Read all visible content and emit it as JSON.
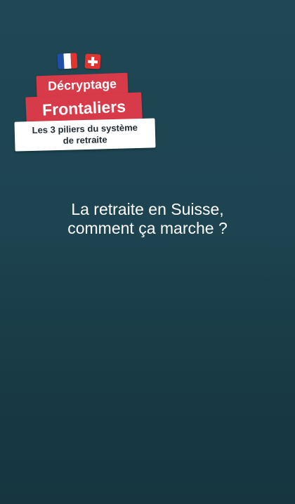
{
  "overlay": {
    "flags": [
      "france-flag-icon",
      "switzerland-flag-icon"
    ],
    "sticker_primary": "Décryptage",
    "sticker_secondary": "Frontaliers",
    "sticker_topic_line1": "Les 3 piliers du système",
    "sticker_topic_line2": "de retraite"
  },
  "headline": {
    "line1": "La retraite en Suisse,",
    "line2": "comment ça marche ?"
  },
  "colors": {
    "background": "#1d4450",
    "accent_red": "#d73a49",
    "text": "#ffffff"
  }
}
